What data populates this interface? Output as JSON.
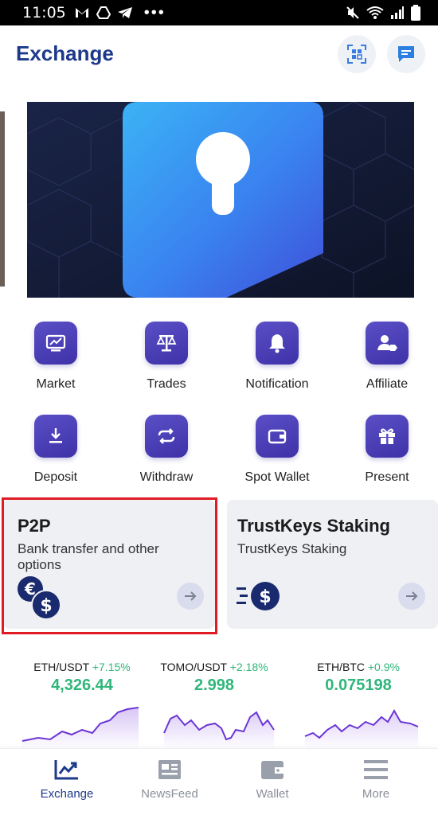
{
  "status_bar": {
    "time": "11:05"
  },
  "header": {
    "title": "Exchange",
    "qr_icon": "qr-scan-icon",
    "chat_icon": "message-icon"
  },
  "banner": {
    "icon": "keyhole-shield-icon"
  },
  "features": [
    {
      "label": "Market",
      "icon": "market-chart-icon"
    },
    {
      "label": "Trades",
      "icon": "balance-scale-icon"
    },
    {
      "label": "Notification",
      "icon": "bell-icon"
    },
    {
      "label": "Affiliate",
      "icon": "user-tag-icon"
    },
    {
      "label": "Deposit",
      "icon": "download-tray-icon"
    },
    {
      "label": "Withdraw",
      "icon": "repeat-arrows-icon"
    },
    {
      "label": "Spot Wallet",
      "icon": "wallet-icon"
    },
    {
      "label": "Present",
      "icon": "gift-icon"
    }
  ],
  "cards": {
    "p2p": {
      "title": "P2P",
      "subtitle": "Bank transfer and other options"
    },
    "staking": {
      "title": "TrustKeys Staking",
      "subtitle": "TrustKeys Staking"
    }
  },
  "tickers": [
    {
      "pair": "ETH/USDT",
      "change": "+7.15%",
      "price": "4,326.44"
    },
    {
      "pair": "TOMO/USDT",
      "change": "+2.18%",
      "price": "2.998"
    },
    {
      "pair": "ETH/BTC",
      "change": "+0.9%",
      "price": "0.075198"
    }
  ],
  "nav": [
    {
      "label": "Exchange",
      "icon": "trend-chart-icon",
      "active": true
    },
    {
      "label": "NewsFeed",
      "icon": "newspaper-icon",
      "active": false
    },
    {
      "label": "Wallet",
      "icon": "wallet-icon",
      "active": false
    },
    {
      "label": "More",
      "icon": "menu-icon",
      "active": false
    }
  ],
  "colors": {
    "brand": "#1d3a8a",
    "accent": "#4a3fb8",
    "positive": "#2fb67a",
    "highlight": "#e01b24"
  }
}
